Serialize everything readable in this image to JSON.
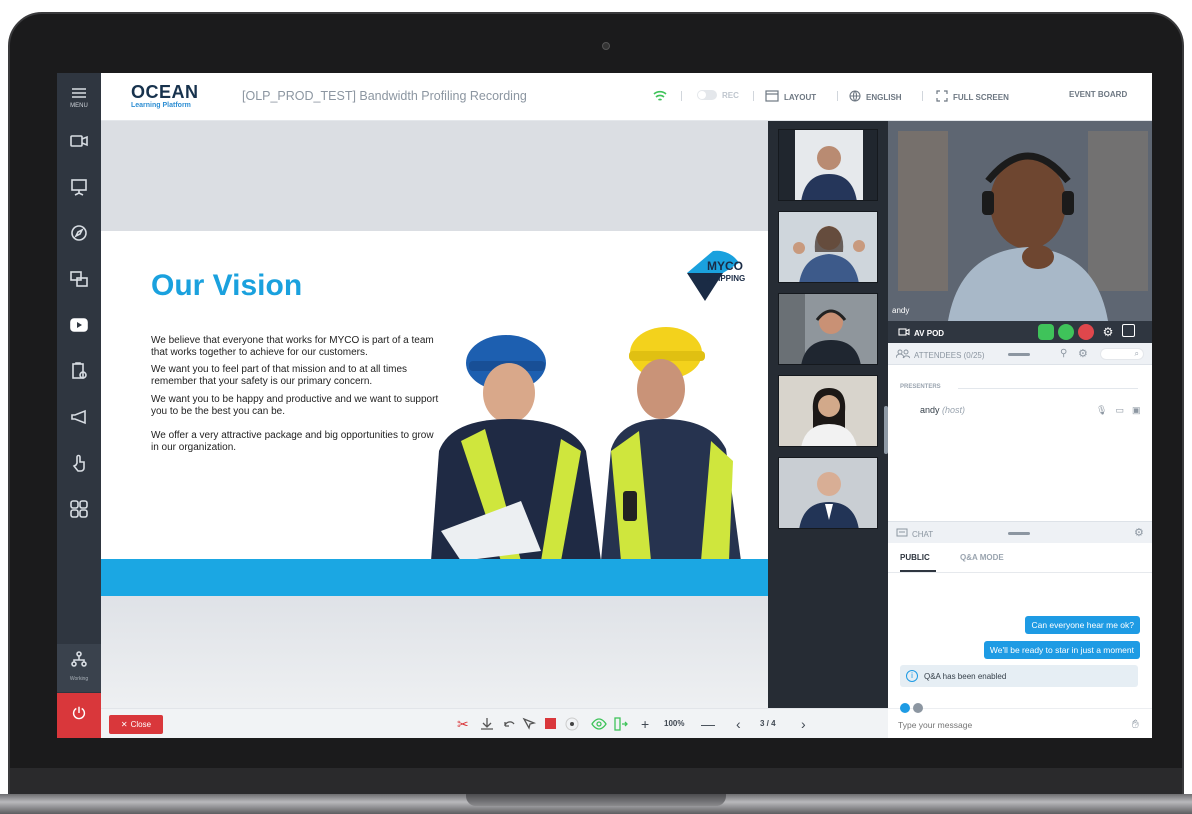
{
  "rail": {
    "menu_label": "MENU",
    "working_label": "Working",
    "items": [
      "menu-icon",
      "camera-icon",
      "presentation-icon",
      "compass-icon",
      "share-screen-icon",
      "youtube-icon",
      "clipboard-check-icon",
      "megaphone-icon",
      "hand-pointer-icon",
      "layout-grid-icon",
      "network-icon",
      "power-icon"
    ]
  },
  "header": {
    "logo": "OCEAN",
    "logo_sub": "Learning Platform",
    "title": "[OLP_PROD_TEST] Bandwidth Profiling Recording",
    "rec_label": "REC",
    "layout_label": "LAYOUT",
    "language_label": "ENGLISH",
    "fullscreen_label": "FULL SCREEN",
    "event_board_label": "EVENT BOARD"
  },
  "slide": {
    "title": "Our Vision",
    "paragraphs": [
      "We believe that everyone that works for MYCO is part of a team that works together to achieve for our customers.",
      "We want you to feel part of that mission and to at all times remember that your safety is our primary concern.",
      "We want you to be happy and productive and we want to support you to be the best you can be.",
      "We offer a very attractive package and big opportunities to grow in our organization."
    ],
    "logo_line1": "MYCO",
    "logo_line2": "SHIPPING"
  },
  "toolbar": {
    "close_label": "Close",
    "zoom": "100%",
    "page": "3 / 4"
  },
  "av": {
    "main_name": "andy",
    "pod_label": "AV POD"
  },
  "attendees": {
    "label": "ATTENDEES (0/25)",
    "section": "PRESENTERS",
    "presenter_name": "andy",
    "presenter_role": "(host)"
  },
  "chat": {
    "label": "CHAT",
    "tab_public": "PUBLIC",
    "tab_qa": "Q&A MODE",
    "messages": [
      "Can everyone hear me ok?",
      "We'll be ready to star in just a moment"
    ],
    "info": "Q&A has been enabled",
    "placeholder": "Type your message"
  },
  "colors": {
    "accent": "#1e9be4",
    "rail": "#2f3640",
    "danger": "#d9373b",
    "slide_blue": "#1aa1de"
  }
}
